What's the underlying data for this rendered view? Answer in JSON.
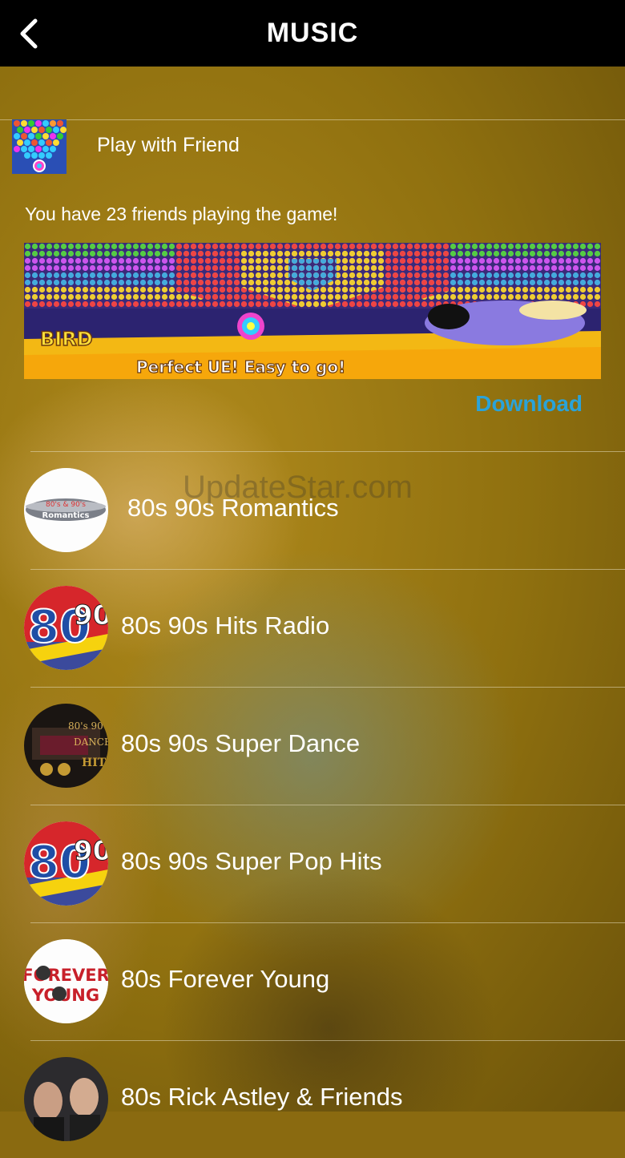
{
  "header": {
    "title": "MUSIC",
    "back_icon": "chevron-left-icon"
  },
  "game_promo": {
    "label": "Play with Friend",
    "friends_text": "You have 23 friends playing the game!",
    "banner_logo": "BIRD BUBBLE",
    "banner_tagline": "Perfect UE! Easy to go!",
    "download_label": "Download"
  },
  "stations": [
    {
      "name": "80s 90s Romantics",
      "logo_text": "80's & 90's Romantics"
    },
    {
      "name": "80s 90s Hits Radio",
      "logo_text": "80 90"
    },
    {
      "name": "80s 90s Super Dance",
      "logo_text": "80s 90s Dance Hits"
    },
    {
      "name": "80s 90s Super Pop Hits",
      "logo_text": "80 90"
    },
    {
      "name": "80s Forever Young",
      "logo_text": "FOREVER YOUNG"
    },
    {
      "name": "80s Rick Astley & Friends",
      "logo_text": ""
    }
  ],
  "watermark": "UpdateStar.com",
  "colors": {
    "navbar": "#000000",
    "background": "#8f700f",
    "download": "#2aa3d9",
    "text": "#ffffff"
  }
}
